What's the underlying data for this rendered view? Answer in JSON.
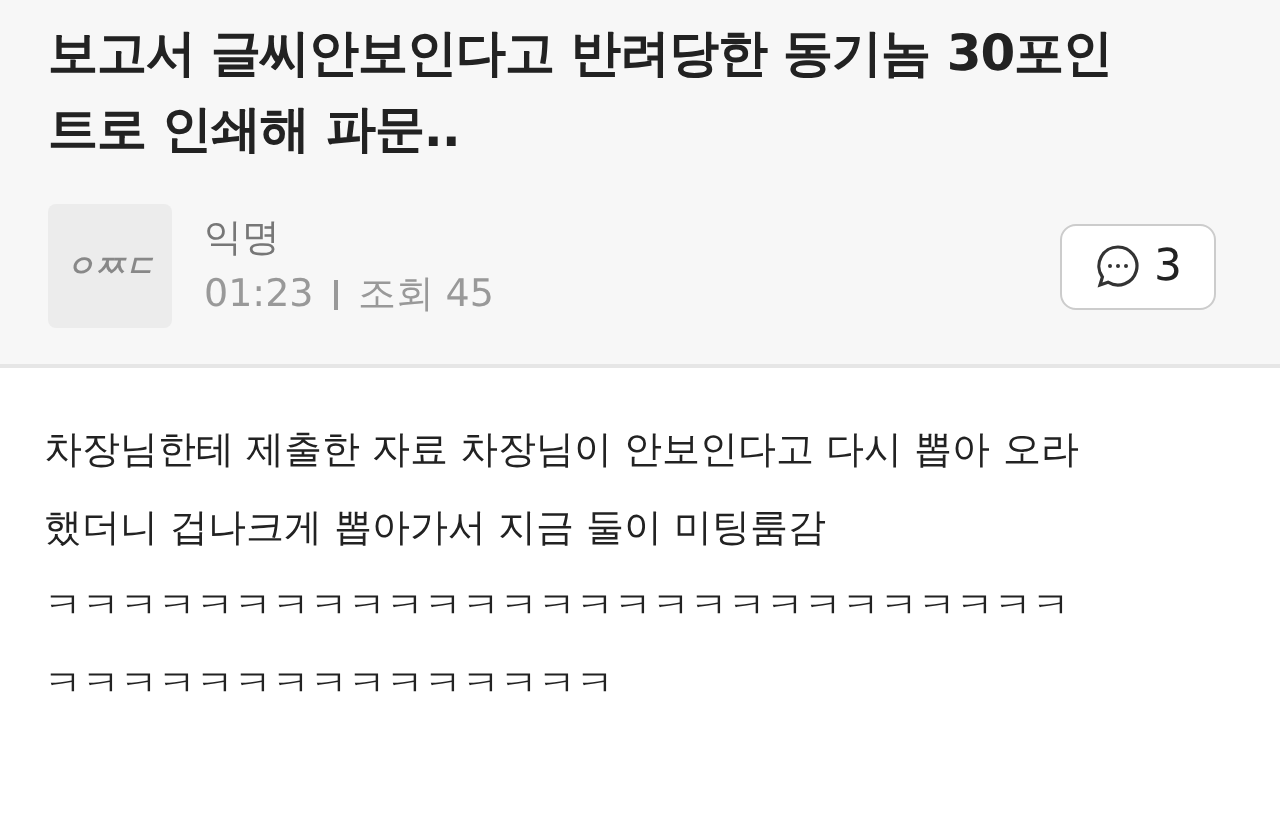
{
  "post": {
    "title_lines": [
      "보고서 글씨안보인다고 반려당한 동기놈 30포인",
      "트로 인쇄해 파문.."
    ],
    "author": {
      "logo": "ㅇㅉㄷ",
      "name": "익명",
      "time": "01:23",
      "views_label": "조회",
      "views": "45"
    },
    "comment_count": "3",
    "body_lines": [
      "차장님한테 제출한 자료 차장님이 안보인다고 다시 뽑아 오라",
      "했더니 겁나크게 뽑아가서 지금 둘이 미팅룸감",
      "ㅋㅋㅋㅋㅋㅋㅋㅋㅋㅋㅋㅋㅋㅋㅋㅋㅋㅋㅋㅋㅋㅋㅋㅋㅋㅋㅋ",
      "ㅋㅋㅋㅋㅋㅋㅋㅋㅋㅋㅋㅋㅋㅋㅋ"
    ]
  }
}
